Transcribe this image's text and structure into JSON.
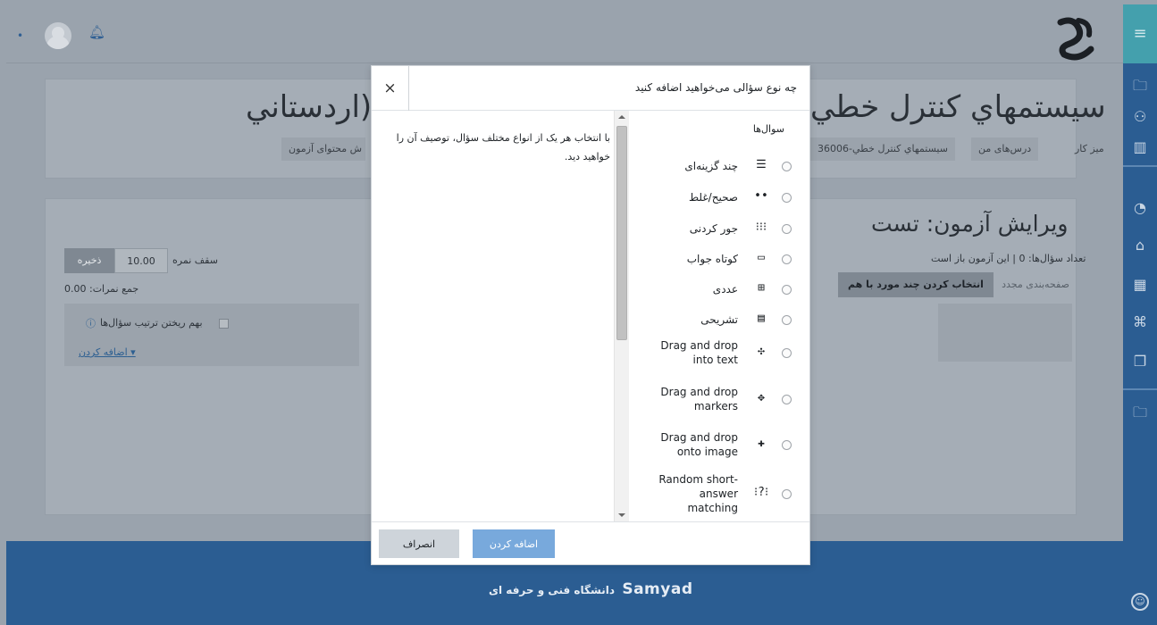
{
  "header": {
    "notifications_icon": "bell-icon",
    "avatar": "user-avatar"
  },
  "sidebar": {
    "icons": [
      "folder-icon",
      "users-icon",
      "book-icon",
      "dashboard-icon",
      "home-icon",
      "calendar-icon",
      "graduation-cap-icon",
      "files-icon",
      "folder-icon"
    ]
  },
  "course": {
    "title_right": "سيستمهاي کنترل خطي",
    "title_left": "اردستاني)",
    "breadcrumb": [
      "میز کار",
      "درس‌های من",
      "سيستمهاي کنترل خطي-36006",
      "ش محتوای آزمون"
    ]
  },
  "quiz": {
    "title": "ویرایش آزمون: تست",
    "info": "تعداد سؤال‌ها: 0 | این آزمون باز است",
    "repaginate": "صفحه‌بندی مجدد",
    "select_multiple": "انتخاب کردن چند مورد با هم",
    "max_grade_label": "سقف نمره",
    "max_grade_value": "10.00",
    "save": "ذخیره",
    "total_marks": "جمع نمرات: 0.00",
    "shuffle": "بهم ریختن ترتیب سؤال‌ها",
    "add": "اضافه کردن ▾"
  },
  "footer": {
    "text": "دانشگاه فنی و حرفه ای",
    "brand": "Samyad"
  },
  "modal": {
    "title": "چه نوع سؤالی می‌خواهید اضافه کنید",
    "close": "×",
    "description": "با انتخاب هر یک از انواع مختلف سؤال، توصیف آن را خواهید دید.",
    "questions_header": "سوال‌ها",
    "questions": [
      {
        "label": "چند گزینه‌ای",
        "icon": "☰"
      },
      {
        "label": "صحیح/غلط",
        "icon": "••"
      },
      {
        "label": "جور کردنی",
        "icon": "⁝⁝⁝"
      },
      {
        "label": "کوتاه جواب",
        "icon": "▭"
      },
      {
        "label": "عددی",
        "icon": "⊞"
      },
      {
        "label": "تشریحی",
        "icon": "▤"
      },
      {
        "label": "Drag and drop\ninto text",
        "icon": "✣"
      },
      {
        "label": "Drag and drop\nmarkers",
        "icon": "✥"
      },
      {
        "label": "Drag and drop\nonto image",
        "icon": "✚"
      },
      {
        "label": "Random short-\nanswer\nmatching",
        "icon": "⁝?⁝"
      }
    ],
    "add_button": "اضافه کردن",
    "cancel_button": "انصراف"
  }
}
